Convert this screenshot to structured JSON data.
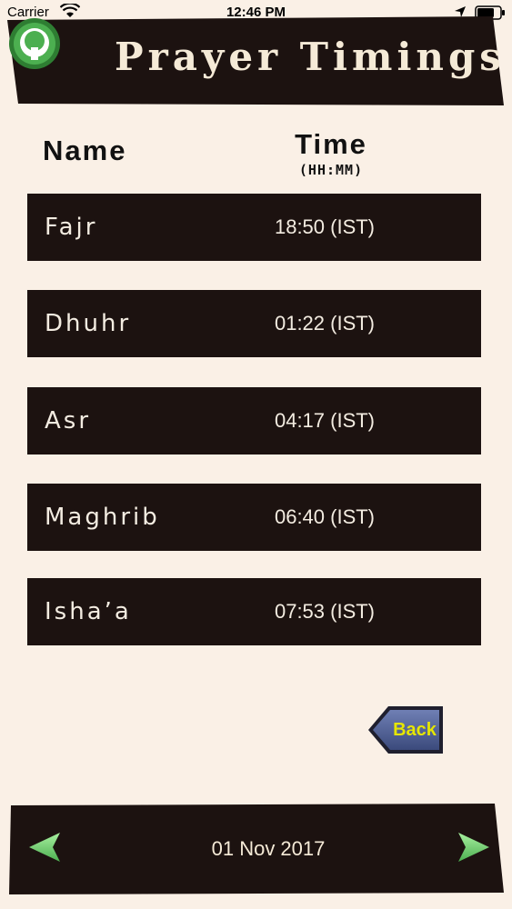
{
  "status_bar": {
    "carrier": "Carrier",
    "time": "12:46 PM"
  },
  "header": {
    "title": "Prayer Timings",
    "logo": "mosque-logo-icon"
  },
  "table": {
    "col_name": "Name",
    "col_time": "Time",
    "col_time_format": "(HH:MM)",
    "rows": [
      {
        "name": "Fajr",
        "time": "18:50 (IST)"
      },
      {
        "name": "Dhuhr",
        "time": "01:22 (IST)"
      },
      {
        "name": "Asr",
        "time": "04:17 (IST)"
      },
      {
        "name": "Maghrib",
        "time": "06:40 (IST)"
      },
      {
        "name": "Isha’a",
        "time": "07:53 (IST)"
      }
    ]
  },
  "back_button": {
    "label": "Back"
  },
  "footer": {
    "date": "01 Nov 2017",
    "prev_icon": "left-arrow-icon",
    "next_icon": "right-arrow-icon"
  },
  "colors": {
    "background": "#faf0e6",
    "row_background": "#1c1210",
    "row_text": "#f3ece1",
    "accent_green": "#4caf50",
    "back_text": "#e6e600"
  }
}
